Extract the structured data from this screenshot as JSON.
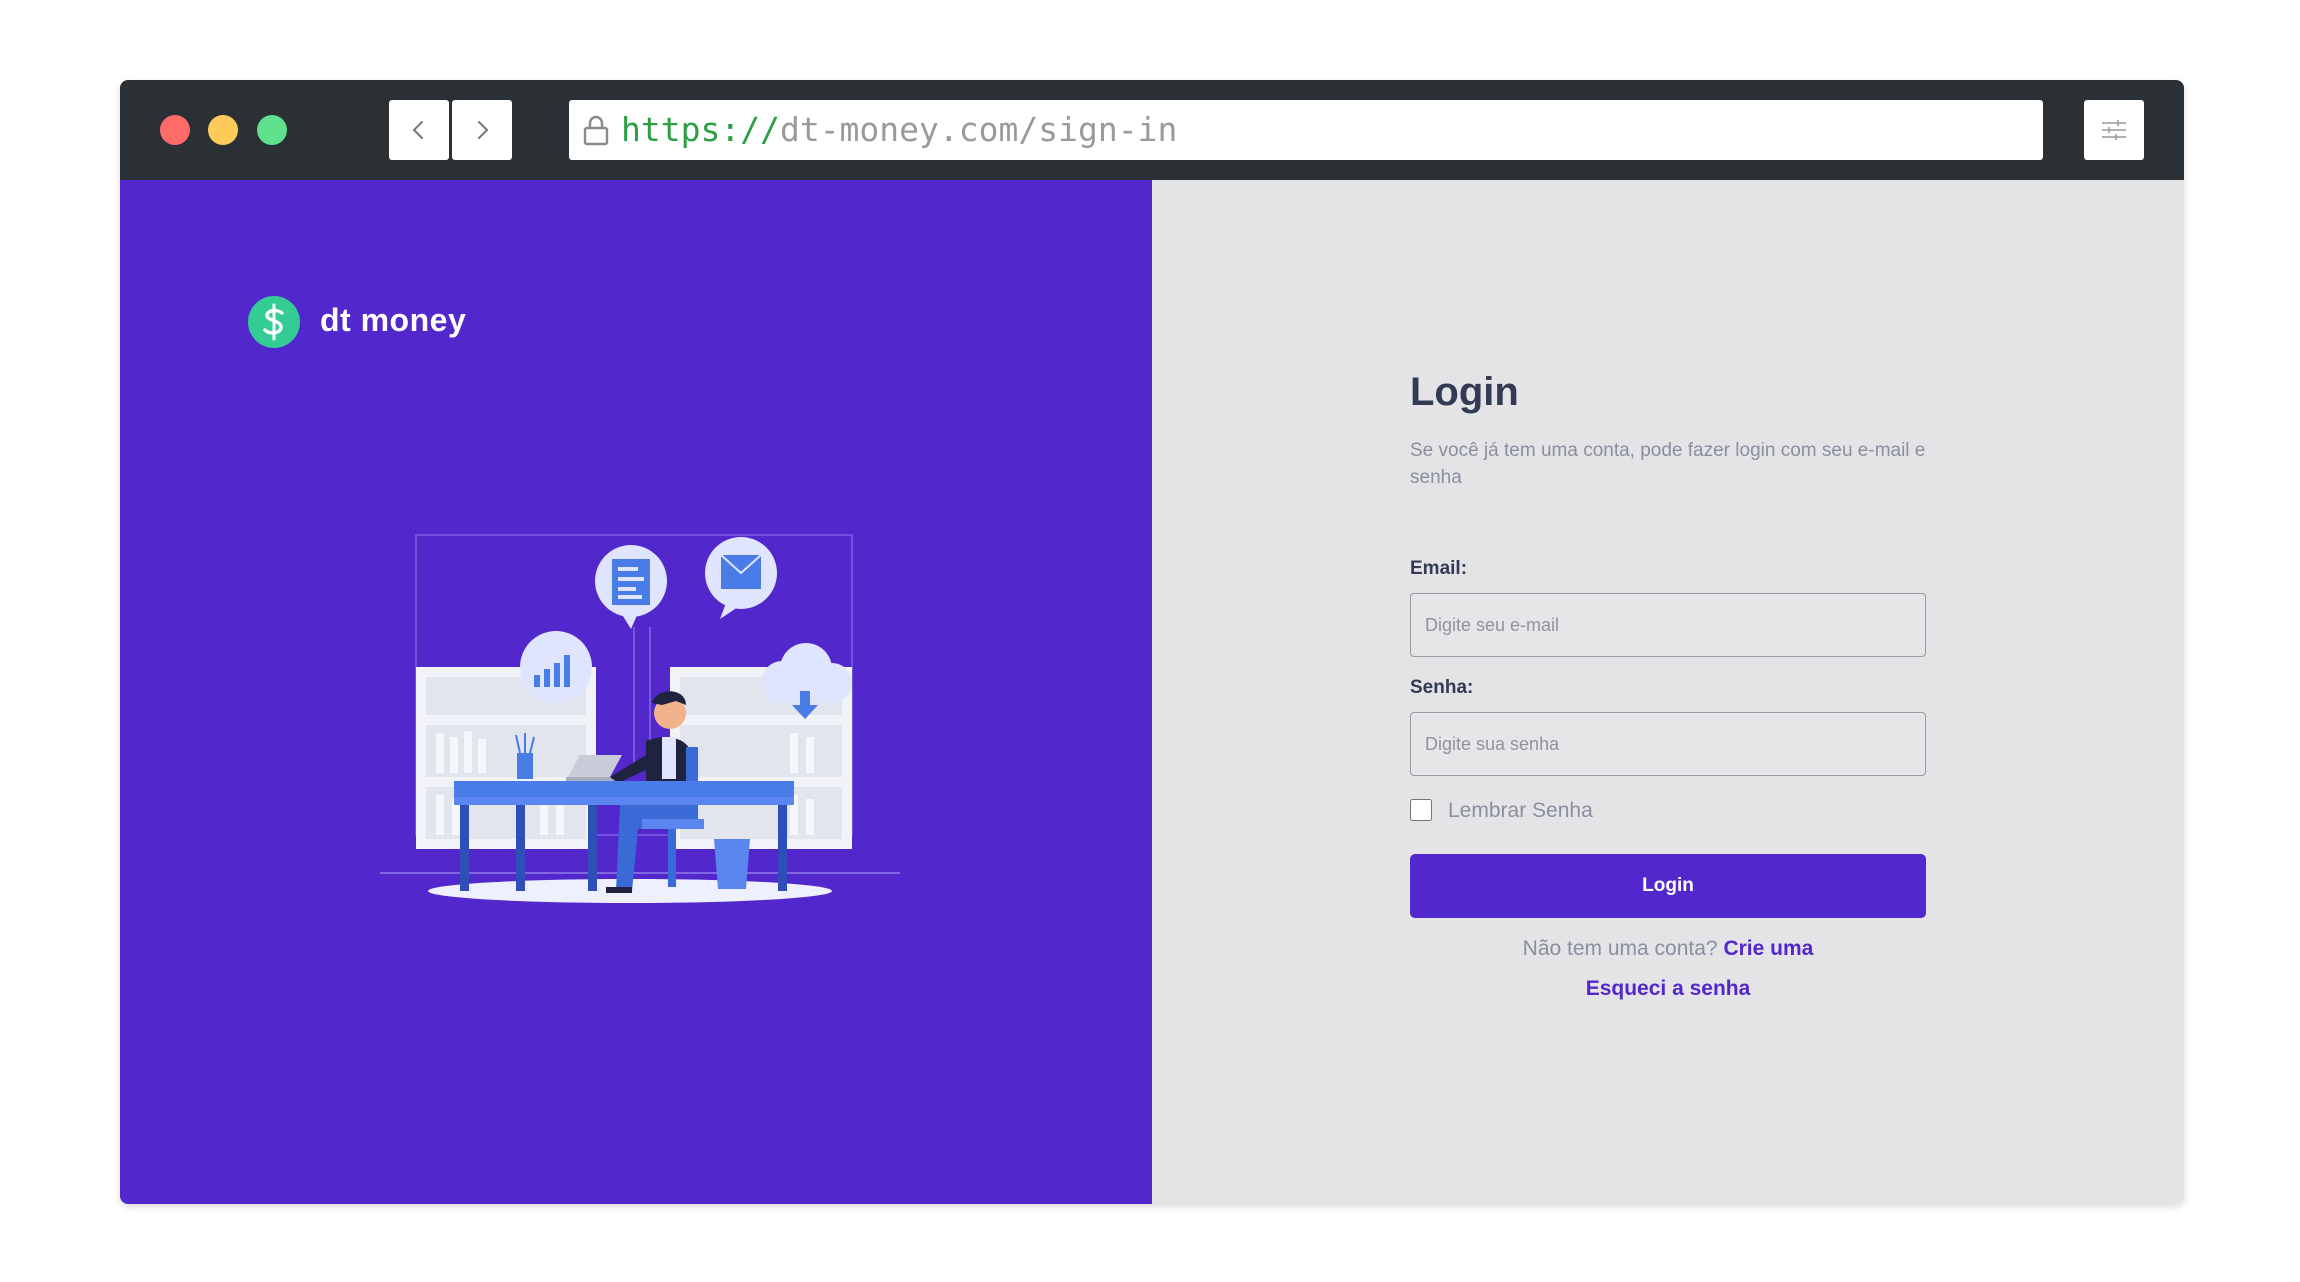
{
  "browser": {
    "url_scheme": "https://",
    "url_rest": "dt-money.com/sign-in",
    "icons": {
      "back": "chevron-left-icon",
      "forward": "chevron-right-icon",
      "lock": "lock-icon",
      "settings": "sliders-icon"
    }
  },
  "brand": {
    "name": "dt money",
    "icon": "dollar-icon",
    "icon_color": "#33cc95"
  },
  "login": {
    "title": "Login",
    "subtitle": "Se você já tem uma conta, pode fazer login com seu e-mail e senha",
    "email_label": "Email:",
    "email_placeholder": "Digite seu e-mail",
    "password_label": "Senha:",
    "password_placeholder": "Digite sua senha",
    "remember_label": "Lembrar Senha",
    "submit_label": "Login",
    "signup_question": "Não tem uma conta?",
    "signup_link": "Crie uma",
    "forgot_link": "Esqueci a senha"
  },
  "colors": {
    "primary": "#5228cc",
    "form_background": "#e4e4e7",
    "title_text": "#323a54",
    "muted_text": "#8a8f9e",
    "browser_chrome": "#2b3035"
  }
}
